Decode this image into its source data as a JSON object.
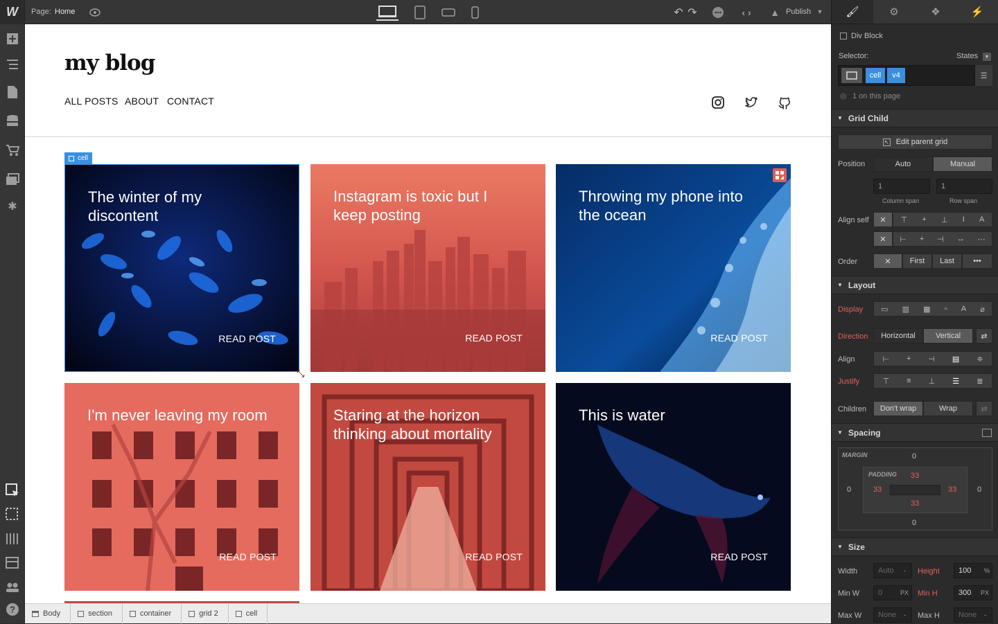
{
  "topbar": {
    "logo": "W",
    "page_label": "Page:",
    "page_name": "Home",
    "publish": "Publish"
  },
  "lefttools": [
    "add-icon",
    "navigator-icon",
    "pages-icon",
    "cms-icon",
    "ecommerce-icon",
    "assets-icon",
    "settings-icon",
    "select-tool-icon",
    "preview-icon",
    "grid-guides-icon",
    "audit-icon",
    "collaborators-icon",
    "help-icon"
  ],
  "blog": {
    "logo": "my blog",
    "nav": [
      "ALL POSTS",
      "ABOUT",
      "CONTACT"
    ],
    "selected_label": "cell",
    "posts": [
      {
        "title": "The winter of my discontent",
        "cta": "READ POST"
      },
      {
        "title": "Instagram is toxic but I keep posting",
        "cta": "READ POST"
      },
      {
        "title": "Throwing my phone into the ocean",
        "cta": "READ POST"
      },
      {
        "title": "I'm never leaving my room",
        "cta": "READ POST"
      },
      {
        "title": "Staring at the horizon thinking about mortality",
        "cta": "READ POST"
      },
      {
        "title": "This is water",
        "cta": "READ POST"
      }
    ]
  },
  "breadcrumbs": [
    "Body",
    "section",
    "container",
    "grid 2",
    "cell"
  ],
  "panel": {
    "element": "Div Block",
    "selector_label": "Selector:",
    "states": "States",
    "classes": [
      "cell",
      "v4"
    ],
    "on_page": "1 on this page",
    "grid_child": {
      "title": "Grid Child",
      "edit_parent": "Edit parent grid",
      "position_label": "Position",
      "auto": "Auto",
      "manual": "Manual",
      "col": "1",
      "row": "1",
      "col_span": "Column span",
      "row_span": "Row span",
      "align_self": "Align self",
      "order": "Order",
      "first": "First",
      "last": "Last"
    },
    "layout": {
      "title": "Layout",
      "display": "Display",
      "direction": "Direction",
      "horizontal": "Horizontal",
      "vertical": "Vertical",
      "align": "Align",
      "justify": "Justify",
      "children": "Children",
      "dont_wrap": "Don't wrap",
      "wrap": "Wrap"
    },
    "spacing": {
      "title": "Spacing",
      "margin": "MARGIN",
      "padding": "PADDING",
      "m_top": "0",
      "m_left": "0",
      "m_right": "0",
      "m_bottom": "0",
      "p_top": "33",
      "p_left": "33",
      "p_right": "33",
      "p_bottom": "33"
    },
    "size": {
      "title": "Size",
      "width": "Width",
      "width_val": "Auto",
      "width_unit": "-",
      "height": "Height",
      "height_val": "100",
      "height_unit": "%",
      "min_w": "Min W",
      "min_w_val": "0",
      "min_w_unit": "PX",
      "min_h": "Min H",
      "min_h_val": "300",
      "min_h_unit": "PX",
      "max_w": "Max W",
      "max_w_val": "None",
      "max_w_unit": "-",
      "max_h": "Max H",
      "max_h_val": "None",
      "max_h_unit": "-"
    }
  }
}
